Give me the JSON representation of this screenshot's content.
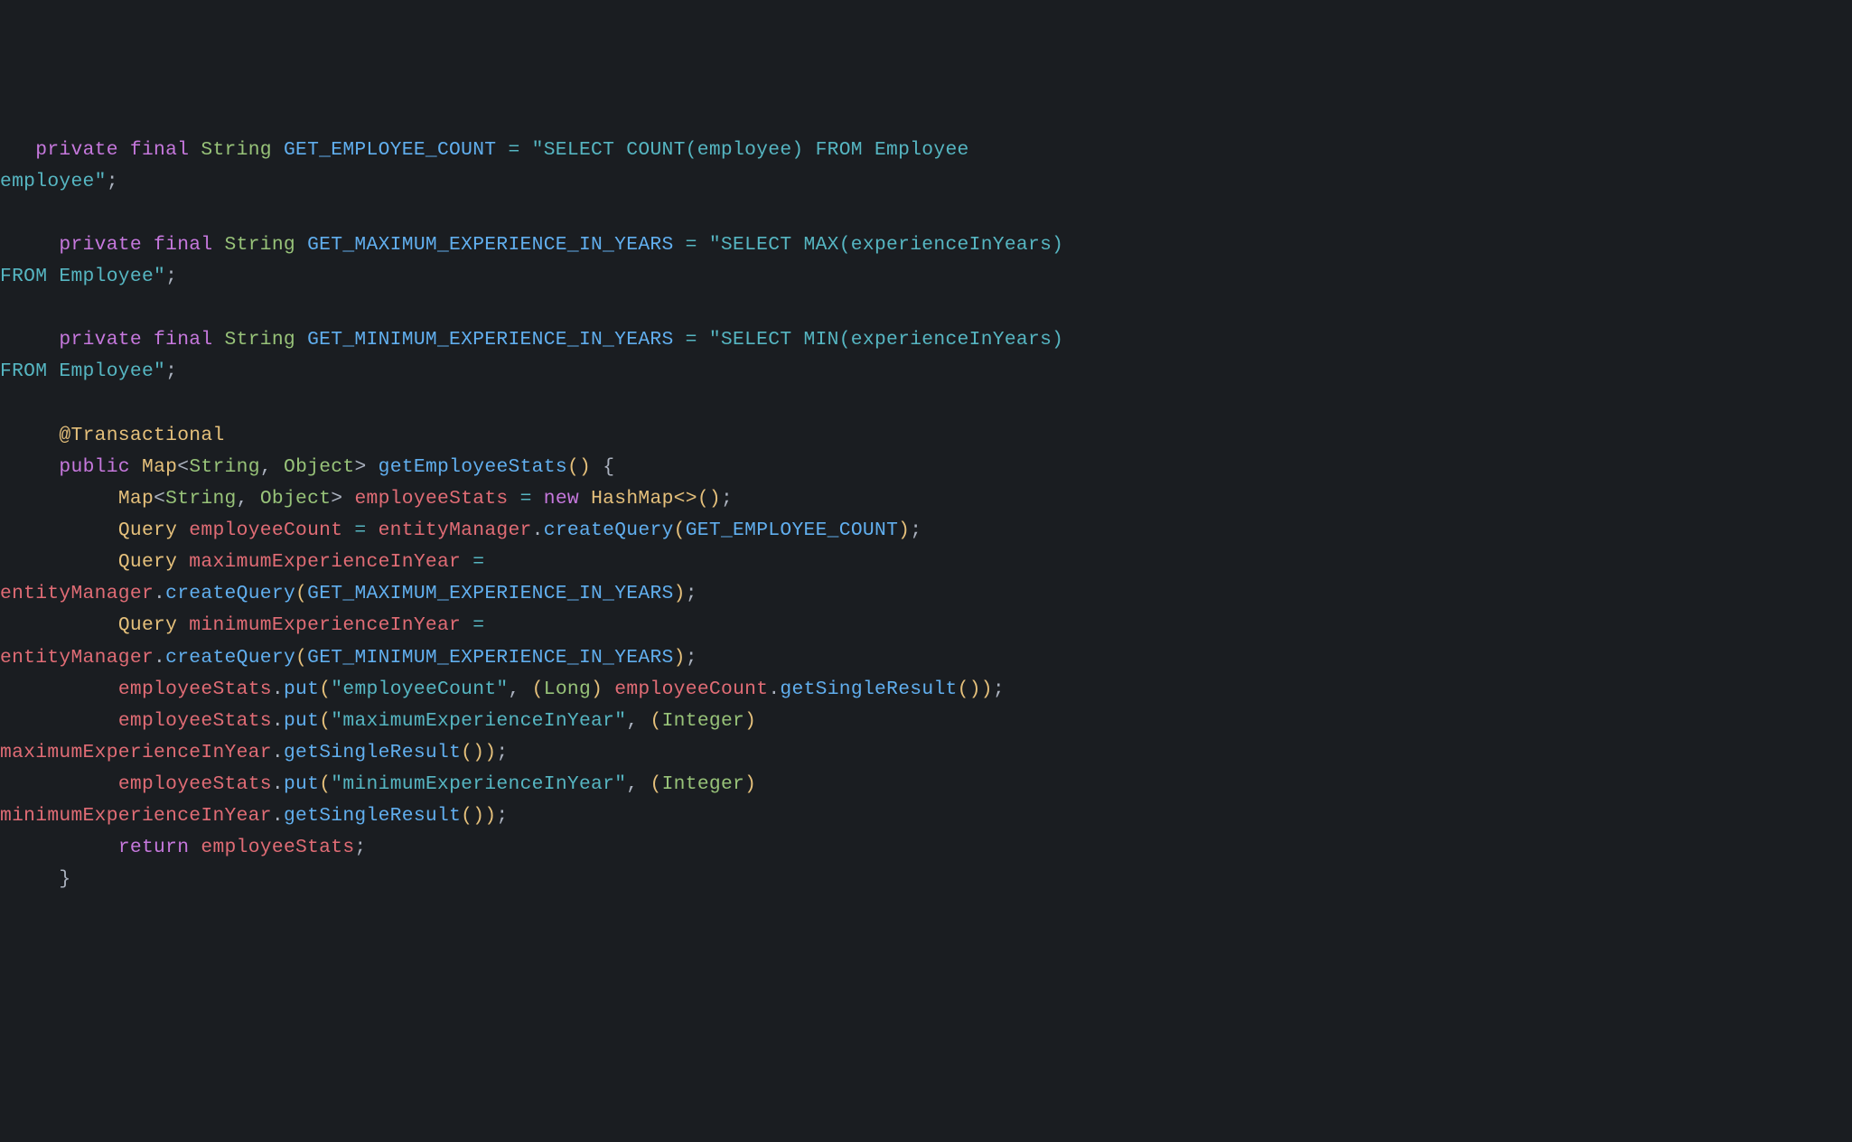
{
  "lines": {
    "l1_indent": "   ",
    "l1_private": "private",
    "l1_final": " final ",
    "l1_type": "String",
    "l1_const": " GET_EMPLOYEE_COUNT ",
    "l1_eq": "= ",
    "l1_str": "\"SELECT COUNT(employee) FROM Employee ",
    "l2_str": "employee\"",
    "l2_semi": ";",
    "l4_indent": "     ",
    "l4_private": "private",
    "l4_final": " final ",
    "l4_type": "String",
    "l4_const": " GET_MAXIMUM_EXPERIENCE_IN_YEARS ",
    "l4_eq": "= ",
    "l4_str": "\"SELECT MAX(experienceInYears) ",
    "l5_str": "FROM Employee\"",
    "l5_semi": ";",
    "l7_indent": "     ",
    "l7_private": "private",
    "l7_final": " final ",
    "l7_type": "String",
    "l7_const": " GET_MINIMUM_EXPERIENCE_IN_YEARS ",
    "l7_eq": "= ",
    "l7_str": "\"SELECT MIN(experienceInYears) ",
    "l8_str": "FROM Employee\"",
    "l8_semi": ";",
    "l10_indent": "     ",
    "l10_annotation": "@Transactional",
    "l11_indent": "     ",
    "l11_public": "public",
    "l11_sp1": " ",
    "l11_map": "Map",
    "l11_lt": "<",
    "l11_string": "String",
    "l11_comma": ", ",
    "l11_object": "Object",
    "l11_gt": "> ",
    "l11_method": "getEmployeeStats",
    "l11_paren": "()",
    "l11_brace": " {",
    "l12_indent": "          ",
    "l12_map": "Map",
    "l12_lt": "<",
    "l12_string": "String",
    "l12_comma": ", ",
    "l12_object": "Object",
    "l12_gt": "> ",
    "l12_var": "employeeStats ",
    "l12_eq": "= ",
    "l12_new": "new",
    "l12_hashmap": " HashMap",
    "l12_diamond": "<>()",
    "l12_semi": ";",
    "l13_indent": "          ",
    "l13_query": "Query ",
    "l13_var": "employeeCount ",
    "l13_eq": "= ",
    "l13_em": "entityManager",
    "l13_dot": ".",
    "l13_method": "createQuery",
    "l13_open": "(",
    "l13_arg": "GET_EMPLOYEE_COUNT",
    "l13_close": ")",
    "l13_semi": ";",
    "l14_indent": "          ",
    "l14_query": "Query ",
    "l14_var": "maximumExperienceInYear ",
    "l14_eq": "= ",
    "l15_em": "entityManager",
    "l15_dot": ".",
    "l15_method": "createQuery",
    "l15_open": "(",
    "l15_arg": "GET_MAXIMUM_EXPERIENCE_IN_YEARS",
    "l15_close": ")",
    "l15_semi": ";",
    "l16_indent": "          ",
    "l16_query": "Query ",
    "l16_var": "minimumExperienceInYear ",
    "l16_eq": "= ",
    "l17_em": "entityManager",
    "l17_dot": ".",
    "l17_method": "createQuery",
    "l17_open": "(",
    "l17_arg": "GET_MINIMUM_EXPERIENCE_IN_YEARS",
    "l17_close": ")",
    "l17_semi": ";",
    "l18_indent": "          ",
    "l18_var": "employeeStats",
    "l18_dot": ".",
    "l18_method": "put",
    "l18_open": "(",
    "l18_str": "\"employeeCount\"",
    "l18_comma": ", ",
    "l18_castopen": "(",
    "l18_cast": "Long",
    "l18_castclose": ") ",
    "l18_var2": "employeeCount",
    "l18_dot2": ".",
    "l18_method2": "getSingleResult",
    "l18_paren": "()",
    "l18_close": ")",
    "l18_semi": ";",
    "l19_indent": "          ",
    "l19_var": "employeeStats",
    "l19_dot": ".",
    "l19_method": "put",
    "l19_open": "(",
    "l19_str": "\"maximumExperienceInYear\"",
    "l19_comma": ", ",
    "l19_castopen": "(",
    "l19_cast": "Integer",
    "l19_castclose": ") ",
    "l20_var": "maximumExperienceInYear",
    "l20_dot": ".",
    "l20_method": "getSingleResult",
    "l20_paren": "()",
    "l20_close": ")",
    "l20_semi": ";",
    "l21_indent": "          ",
    "l21_var": "employeeStats",
    "l21_dot": ".",
    "l21_method": "put",
    "l21_open": "(",
    "l21_str": "\"minimumExperienceInYear\"",
    "l21_comma": ", ",
    "l21_castopen": "(",
    "l21_cast": "Integer",
    "l21_castclose": ") ",
    "l22_var": "minimumExperienceInYear",
    "l22_dot": ".",
    "l22_method": "getSingleResult",
    "l22_paren": "()",
    "l22_close": ")",
    "l22_semi": ";",
    "l23_indent": "          ",
    "l23_return": "return",
    "l23_var": " employeeStats",
    "l23_semi": ";",
    "l24_indent": "     ",
    "l24_brace": "}"
  }
}
